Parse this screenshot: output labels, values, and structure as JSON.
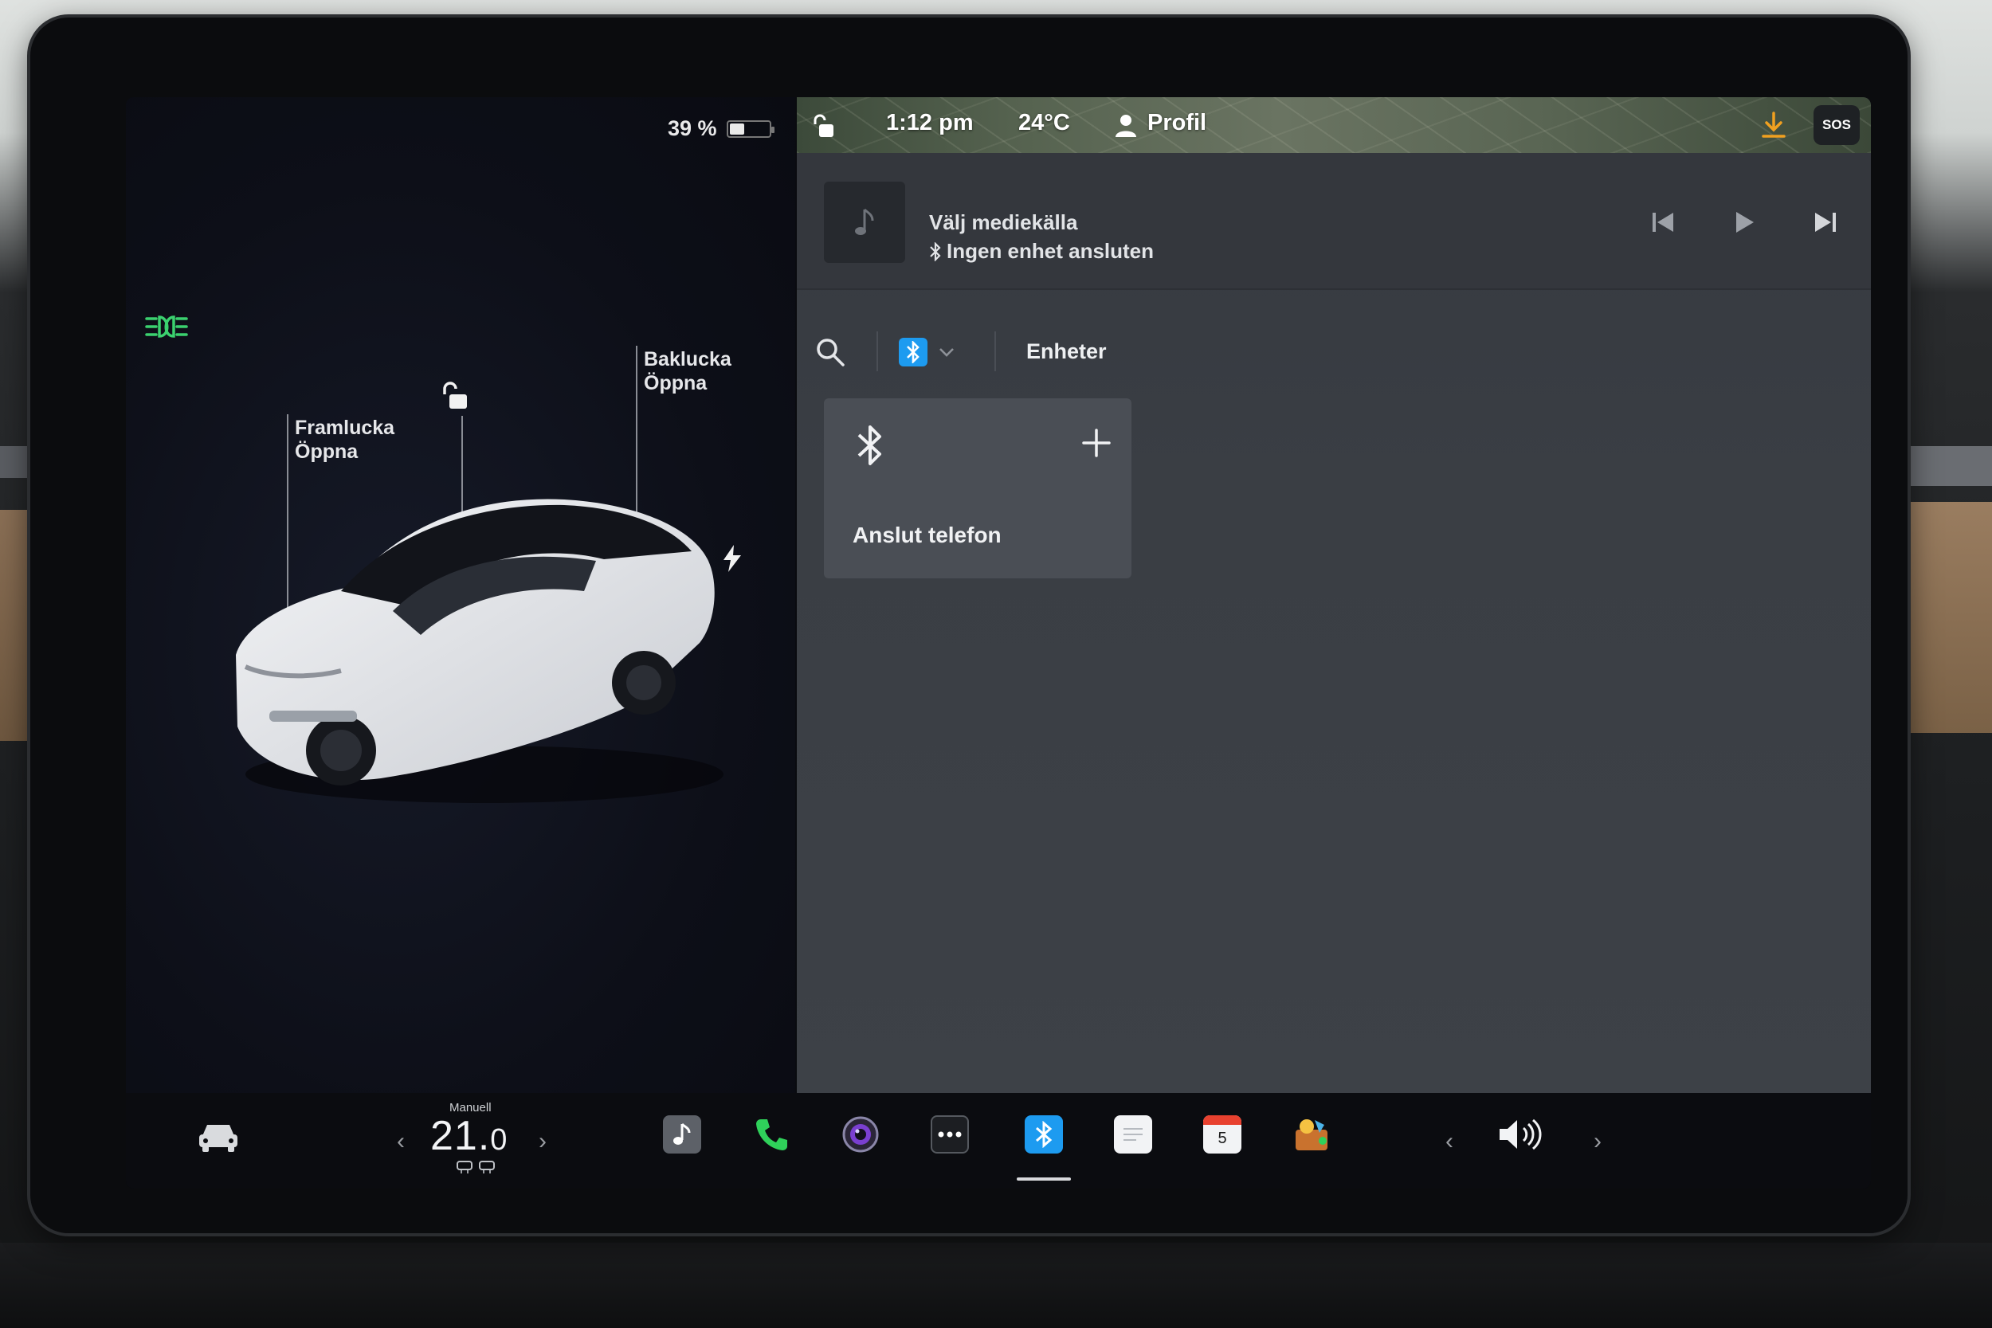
{
  "left_panel": {
    "battery_percent": "39 %",
    "battery_level": 0.39,
    "front_trunk": {
      "title": "Framlucka",
      "action": "Öppna"
    },
    "rear_trunk": {
      "title": "Baklucka",
      "action": "Öppna"
    }
  },
  "status_bar": {
    "time": "1:12 pm",
    "temperature": "24°C",
    "profile_label": "Profil",
    "sos_label": "SOS"
  },
  "media": {
    "title": "Välj mediekälla",
    "subtitle": "Ingen enhet ansluten"
  },
  "toolbar": {
    "devices_tab": "Enheter"
  },
  "connect_card": {
    "label": "Anslut telefon"
  },
  "dock": {
    "climate_mode": "Manuell",
    "temp_whole": "21.",
    "temp_decimal": "0",
    "calendar_day": "5",
    "prev_arrow": "‹",
    "next_arrow": "›"
  },
  "colors": {
    "bluetooth_accent": "#1d9bf0",
    "headlight_green": "#3bd16f",
    "download_orange": "#f0a020",
    "phone_green": "#2fd15a"
  }
}
